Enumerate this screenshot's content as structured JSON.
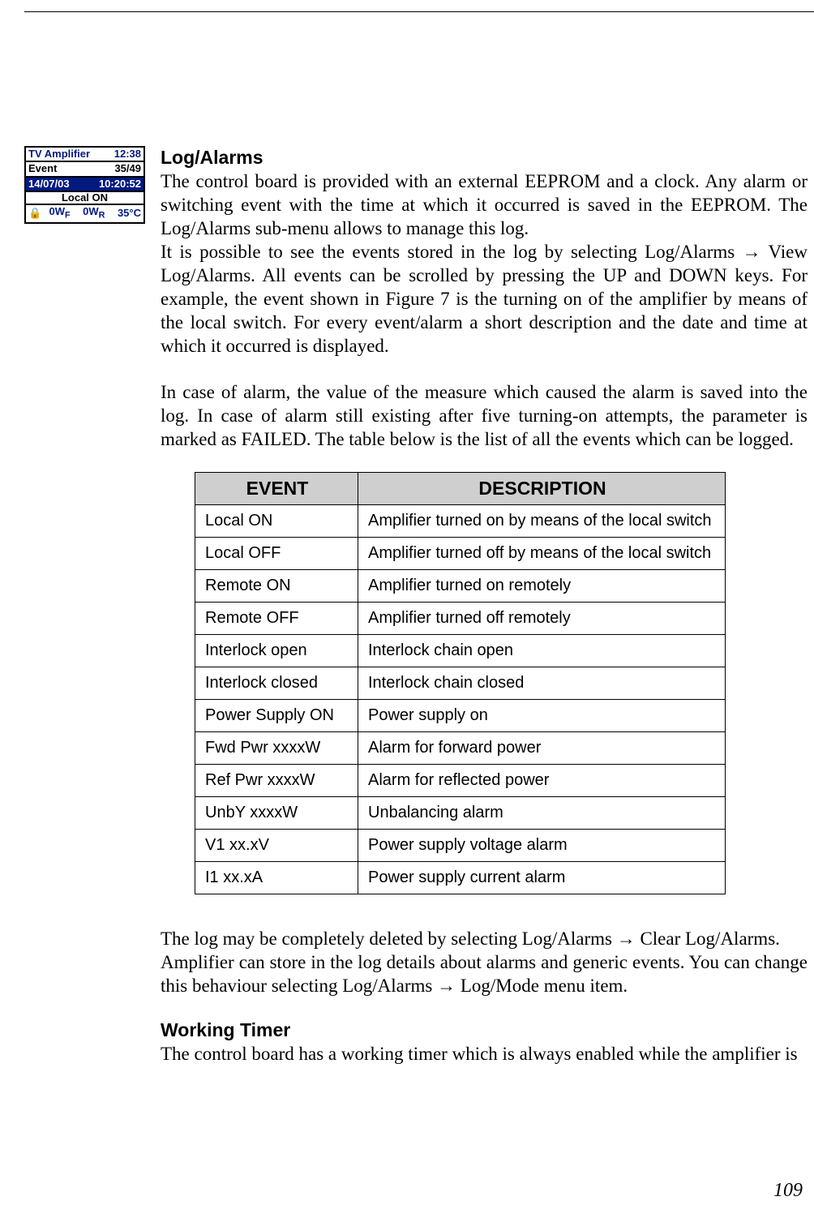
{
  "page_number": "109",
  "lcd": {
    "title": "TV  Amplifier",
    "clock": "12:38",
    "event_label": "Event",
    "event_count": "35/49",
    "date": "14/07/03",
    "time": "10:20:52",
    "local": "Local  ON",
    "status_left": "0W",
    "status_left_sub": "F",
    "status_mid": "0W",
    "status_mid_sub": "R",
    "status_right": "35°C",
    "lock_glyph": "🔒"
  },
  "section1": {
    "heading": "Log/Alarms",
    "p1": "The control board is provided with an external EEPROM and a clock. Any alarm or switching event with the time at which it occurred is saved in the EEPROM. The Log/Alarms sub-menu allows to manage this log.",
    "p2": "It is possible to see the events stored in the log by selecting Log/Alarms → View Log/Alarms. All events can be scrolled by pressing the UP and DOWN keys. For example, the event shown in Figure 7 is the turning on of the amplifier by means of the local switch. For every event/alarm a short description and the date and time at which it occurred is displayed.",
    "p3": "In case of alarm, the value of the measure which caused the alarm is saved into the log. In case of alarm still existing after five turning-on attempts, the parameter is marked as FAILED. The table below is the list of all the events which can be logged."
  },
  "table": {
    "headers": {
      "event": "EVENT",
      "description": "DESCRIPTION"
    },
    "rows": [
      {
        "event": "Local ON",
        "description": "Amplifier turned on by means of the local switch"
      },
      {
        "event": "Local OFF",
        "description": "Amplifier turned off by means of the local switch"
      },
      {
        "event": "Remote ON",
        "description": "Amplifier turned on remotely"
      },
      {
        "event": "Remote OFF",
        "description": "Amplifier turned off remotely"
      },
      {
        "event": "Interlock open",
        "description": "Interlock chain open"
      },
      {
        "event": "Interlock closed",
        "description": "Interlock chain closed"
      },
      {
        "event": "Power Supply ON",
        "description": "Power supply on"
      },
      {
        "event": "Fwd Pwr xxxxW",
        "description": "Alarm for forward power"
      },
      {
        "event": "Ref Pwr xxxxW",
        "description": "Alarm for reflected power"
      },
      {
        "event": "UnbY xxxxW",
        "description": "Unbalancing alarm"
      },
      {
        "event": "V1 xx.xV",
        "description": "Power supply voltage alarm"
      },
      {
        "event": "I1 xx.xA",
        "description": "Power supply current alarm"
      }
    ]
  },
  "after_table": {
    "p1": "The log may be completely deleted by selecting Log/Alarms → Clear Log/Alarms.",
    "p2": "Amplifier can store in the log details about alarms and generic events. You can change this behaviour selecting Log/Alarms → Log/Mode menu item."
  },
  "section2": {
    "heading": "Working Timer",
    "p1": "The control board has a working timer which is always enabled while the amplifier is"
  }
}
